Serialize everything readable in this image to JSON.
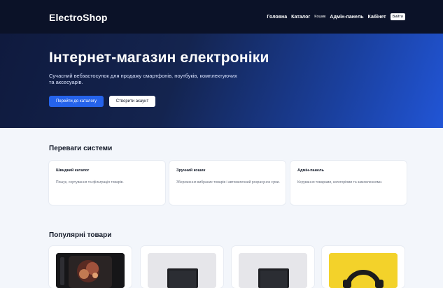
{
  "header": {
    "logo": "ElectroShop",
    "nav": [
      {
        "label": "Головна"
      },
      {
        "label": "Каталог"
      },
      {
        "label": "Кошик"
      },
      {
        "label": "Адмін-панель"
      },
      {
        "label": "Кабінет"
      }
    ],
    "logout_label": "Вийти"
  },
  "hero": {
    "title": "Інтернет-магазин електроніки",
    "subtitle": "Сучасний вебзастосунок для продажу смартфонів, ноутбуків, комплектуючих та аксесуарів.",
    "primary_button": "Перейти до каталогу",
    "secondary_button": "Створити акаунт"
  },
  "advantages": {
    "title": "Переваги системи",
    "cards": [
      {
        "title": "Швидкий каталог",
        "text": "Пошук, сортування та фільтрація товарів."
      },
      {
        "title": "Зручний кошик",
        "text": "Збереження вибраних товарів і автоматичний розрахунок суми."
      },
      {
        "title": "Адмін-панель",
        "text": "Керування товарами, категоріями та замовленнями."
      }
    ]
  },
  "popular": {
    "title": "Популярні товари",
    "products": [
      {
        "image": "dark-phone-image"
      },
      {
        "image": "laptop-image"
      },
      {
        "image": "laptop-image"
      },
      {
        "image": "yellow-headphones-image"
      }
    ]
  },
  "colors": {
    "header_bg": "#0b1228",
    "hero_gradient_start": "#0f1a3e",
    "hero_gradient_end": "#2155d6",
    "accent": "#2563eb",
    "page_bg": "#f3f6fb"
  }
}
